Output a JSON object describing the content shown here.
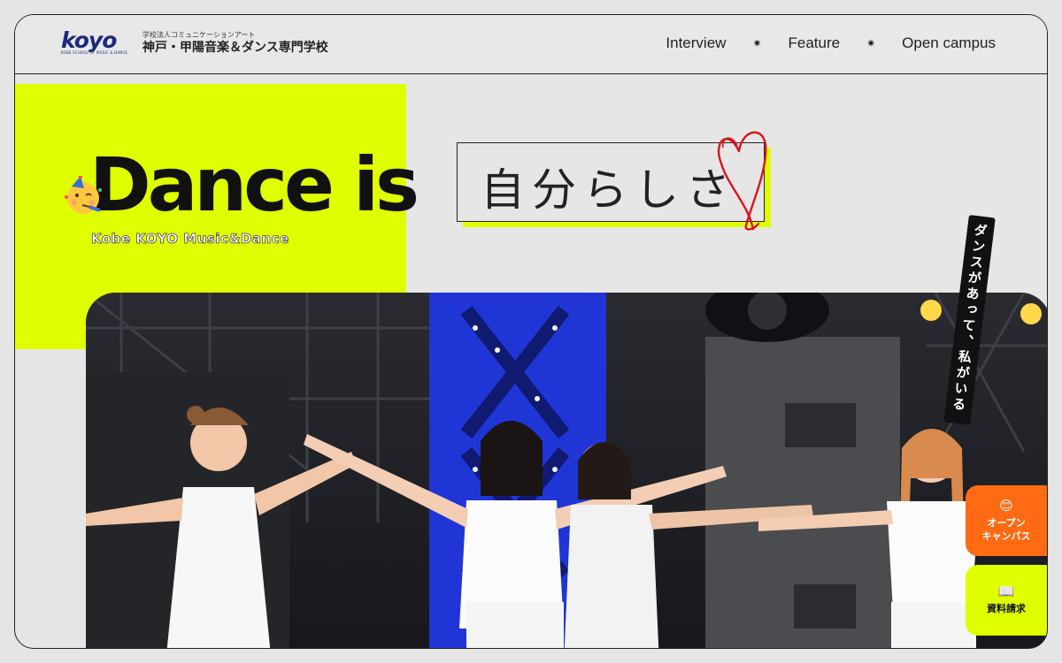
{
  "header": {
    "logo_text": "koyo",
    "logo_subtext": "KOBE SCHOOL OF MUSIC & DANCE",
    "school_small": "学校法人コミュニケーションアート",
    "school_name": "神戸・甲陽音楽＆ダンス専門学校"
  },
  "nav": {
    "items": [
      {
        "label": "Interview"
      },
      {
        "label": "Feature"
      },
      {
        "label": "Open campus"
      }
    ],
    "separator": "✷"
  },
  "hero": {
    "headline": "Dance is",
    "handwritten": "自分らしさ",
    "subline": "Kobe KOYO Music&Dance",
    "emoji_icon": "party-face-icon"
  },
  "badge": {
    "text": "ダンスがあって、私がいる"
  },
  "cta": {
    "open_campus": {
      "icon": "😊",
      "line1": "オープン",
      "line2": "キャンパス"
    },
    "documents": {
      "icon": "📖",
      "label": "資料請求"
    }
  },
  "colors": {
    "lime": "#dfff00",
    "orange": "#ff6a13",
    "navy": "#1e2a7a",
    "heart_red": "#d8141c"
  }
}
